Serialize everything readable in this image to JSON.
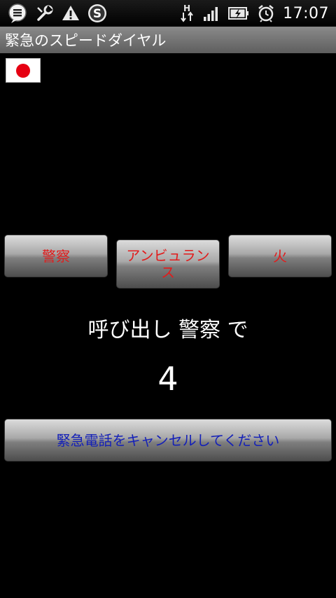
{
  "status_bar": {
    "time": "17:07",
    "icons": [
      "notes-app-icon",
      "tools-icon",
      "warning-icon",
      "skype-icon",
      "data-transfer-icon",
      "signal-icon",
      "battery-charging-icon",
      "alarm-clock-icon"
    ],
    "network_label": "H"
  },
  "title_bar": {
    "title": "緊急のスピードダイヤル"
  },
  "flag": {
    "icon": "japan-flag-icon",
    "colors": {
      "field": "#ffffff",
      "sun": "#e60012"
    }
  },
  "services": {
    "police": "警察",
    "ambulance": "アンビュランス",
    "fire": "火"
  },
  "calling": {
    "text": "呼び出し 警察 で",
    "countdown": "4"
  },
  "cancel_button": {
    "label": "緊急電話をキャンセルしてください"
  },
  "colors": {
    "service_text": "#e21b1b",
    "cancel_text": "#1420b8",
    "background": "#000000"
  }
}
